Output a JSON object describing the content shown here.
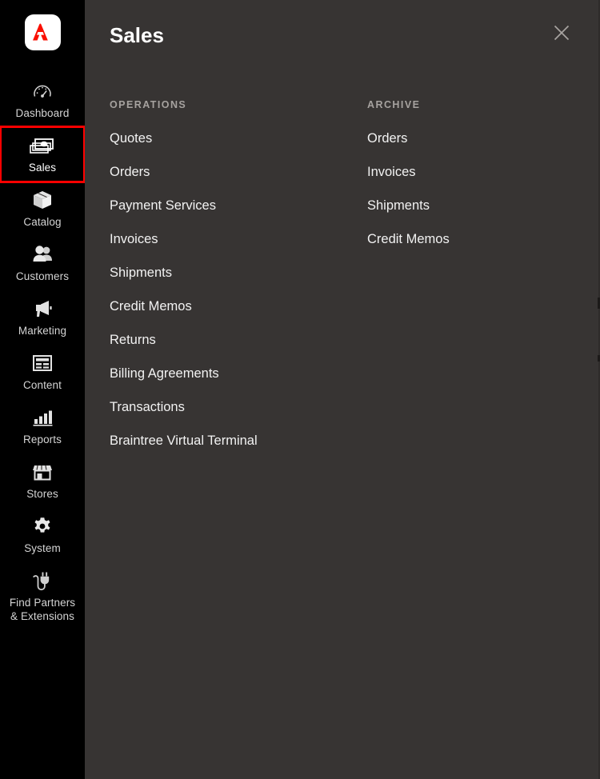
{
  "colors": {
    "sidebar_bg": "#000000",
    "panel_bg": "#373433",
    "accent_red": "#ff0000",
    "brand_red": "#fa0f00",
    "label": "#d4d4d4",
    "column_title": "#a6a29f"
  },
  "sidebar": {
    "logo_name": "adobe-commerce-logo",
    "items": [
      {
        "label": "Dashboard",
        "icon": "gauge-icon",
        "selected": false
      },
      {
        "label": "Sales",
        "icon": "money-stack-icon",
        "selected": true
      },
      {
        "label": "Catalog",
        "icon": "box-icon",
        "selected": false
      },
      {
        "label": "Customers",
        "icon": "people-icon",
        "selected": false
      },
      {
        "label": "Marketing",
        "icon": "megaphone-icon",
        "selected": false
      },
      {
        "label": "Content",
        "icon": "page-layout-icon",
        "selected": false
      },
      {
        "label": "Reports",
        "icon": "bar-chart-icon",
        "selected": false
      },
      {
        "label": "Stores",
        "icon": "storefront-icon",
        "selected": false
      },
      {
        "label": "System",
        "icon": "gear-icon",
        "selected": false
      },
      {
        "label": "Find Partners\n& Extensions",
        "icon": "plug-icon",
        "selected": false
      }
    ]
  },
  "panel": {
    "title": "Sales",
    "close_icon": "close-icon",
    "columns": [
      {
        "title": "OPERATIONS",
        "items": [
          "Quotes",
          "Orders",
          "Payment Services",
          "Invoices",
          "Shipments",
          "Credit Memos",
          "Returns",
          "Billing Agreements",
          "Transactions",
          "Braintree Virtual Terminal"
        ]
      },
      {
        "title": "ARCHIVE",
        "items": [
          "Orders",
          "Invoices",
          "Shipments",
          "Credit Memos"
        ]
      }
    ]
  }
}
